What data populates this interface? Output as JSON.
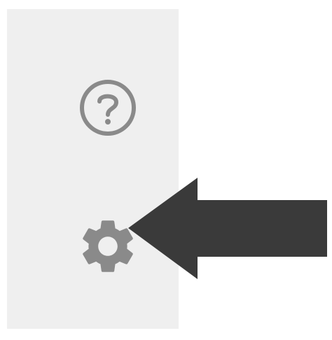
{
  "sidebar": {
    "items": [
      {
        "id": "help",
        "icon": "help-circle-icon"
      },
      {
        "id": "settings",
        "icon": "gear-icon"
      }
    ]
  },
  "annotation": {
    "icon": "arrow-left-icon",
    "points_to": "settings"
  },
  "colors": {
    "sidebar_bg": "#efefef",
    "icon": "#8a8a8a",
    "arrow": "#3a3a3a",
    "page_bg": "#ffffff"
  }
}
